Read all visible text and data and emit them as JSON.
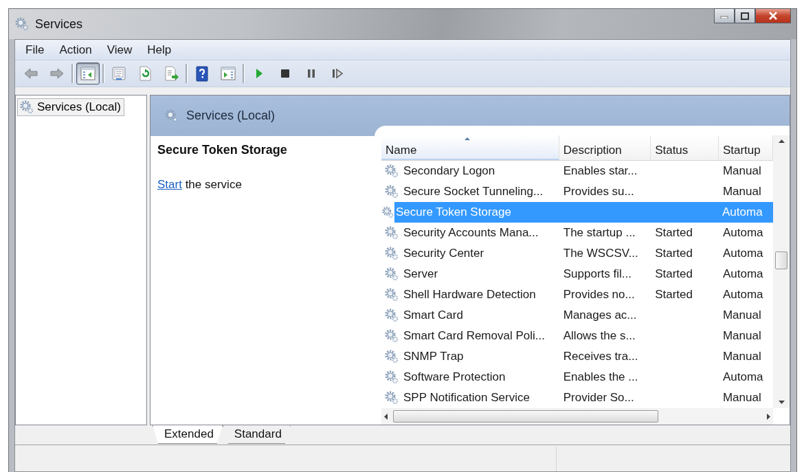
{
  "window": {
    "title": "Services"
  },
  "menu": [
    "File",
    "Action",
    "View",
    "Help"
  ],
  "toolbar": [
    {
      "kind": "back",
      "pressed": false
    },
    {
      "kind": "forward",
      "pressed": false
    },
    {
      "kind": "separator"
    },
    {
      "kind": "console-tree",
      "pressed": true
    },
    {
      "kind": "separator"
    },
    {
      "kind": "properties",
      "pressed": false
    },
    {
      "kind": "refresh",
      "pressed": false
    },
    {
      "kind": "export",
      "pressed": false
    },
    {
      "kind": "separator"
    },
    {
      "kind": "help",
      "pressed": false
    },
    {
      "kind": "action-pane",
      "pressed": false
    },
    {
      "kind": "separator"
    },
    {
      "kind": "start",
      "pressed": false
    },
    {
      "kind": "stop",
      "pressed": false
    },
    {
      "kind": "pause",
      "pressed": false
    },
    {
      "kind": "resume",
      "pressed": false
    }
  ],
  "tree": {
    "items": [
      {
        "label": "Services (Local)",
        "selected": true
      }
    ]
  },
  "header": {
    "title": "Services (Local)"
  },
  "detail": {
    "title": "Secure Token Storage",
    "link": "Start",
    "text": "the service"
  },
  "table": {
    "columns": [
      {
        "label": "Name",
        "sorted": true
      },
      {
        "label": "Description",
        "sorted": false
      },
      {
        "label": "Status",
        "sorted": false
      },
      {
        "label": "Startup",
        "sorted": false
      }
    ],
    "rows": [
      {
        "name": "Secondary Logon",
        "description": "Enables star...",
        "startup": "Manual",
        "selected": false
      },
      {
        "name": "Secure Socket Tunneling...",
        "description": "Provides su...",
        "startup": "Manual",
        "selected": false
      },
      {
        "name": "Secure Token Storage",
        "startup": "Automa",
        "selected": true
      },
      {
        "name": "Security Accounts Mana...",
        "description": "The startup ...",
        "status": "Started",
        "startup": "Automa",
        "selected": false
      },
      {
        "name": "Security Center",
        "description": "The WSCSV...",
        "status": "Started",
        "startup": "Automa",
        "selected": false
      },
      {
        "name": "Server",
        "description": "Supports fil...",
        "status": "Started",
        "startup": "Automa",
        "selected": false
      },
      {
        "name": "Shell Hardware Detection",
        "description": "Provides no...",
        "status": "Started",
        "startup": "Automa",
        "selected": false
      },
      {
        "name": "Smart Card",
        "description": "Manages ac...",
        "startup": "Manual",
        "selected": false
      },
      {
        "name": "Smart Card Removal Poli...",
        "description": "Allows the s...",
        "startup": "Manual",
        "selected": false
      },
      {
        "name": "SNMP Trap",
        "description": "Receives tra...",
        "startup": "Manual",
        "selected": false
      },
      {
        "name": "Software Protection",
        "description": "Enables the ...",
        "startup": "Automa",
        "selected": false
      },
      {
        "name": "SPP Notification Service",
        "description": "Provider So...",
        "startup": "Manual",
        "selected": false
      }
    ]
  },
  "tabs": [
    {
      "label": "Extended",
      "selected": true
    },
    {
      "label": "Standard",
      "selected": false
    }
  ]
}
